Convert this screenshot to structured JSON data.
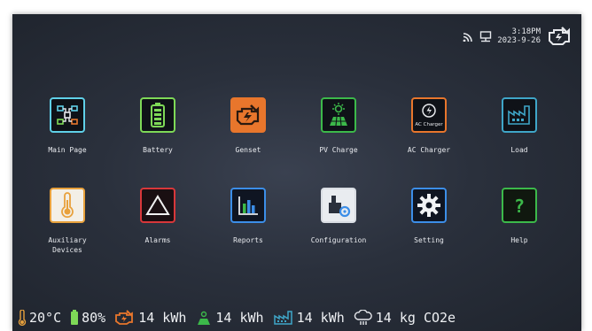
{
  "header": {
    "time": "3:18PM",
    "date": "2023-9-26",
    "icons": [
      "wifi-icon",
      "network-icon",
      "genset-status-icon"
    ]
  },
  "menu": {
    "row1": [
      {
        "label": "Main Page",
        "icon": "main-page-icon",
        "color": "#5fd0e8"
      },
      {
        "label": "Battery",
        "icon": "battery-icon",
        "color": "#7ed957"
      },
      {
        "label": "Genset",
        "icon": "genset-icon",
        "color": "#e8762c"
      },
      {
        "label": "PV Charge",
        "icon": "pv-charge-icon",
        "color": "#3cb94a"
      },
      {
        "label": "AC Charger",
        "icon": "ac-charger-icon",
        "color": "#e8762c",
        "inner_text": "AC Charger"
      },
      {
        "label": "Load",
        "icon": "load-icon",
        "color": "#3fa6c8"
      }
    ],
    "row2": [
      {
        "label": "Auxiliary\nDevices",
        "icon": "thermometer-icon",
        "color": "#e8a13c"
      },
      {
        "label": "Alarms",
        "icon": "alarm-icon",
        "color": "#d8373a"
      },
      {
        "label": "Reports",
        "icon": "reports-icon",
        "color": "#3c8ee8"
      },
      {
        "label": "Configuration",
        "icon": "configuration-icon",
        "color": "#d9dde3"
      },
      {
        "label": "Setting",
        "icon": "setting-icon",
        "color": "#3c8ee8"
      },
      {
        "label": "Help",
        "icon": "help-icon",
        "color": "#3cb94a"
      }
    ]
  },
  "status": {
    "temperature": "20°C",
    "battery": "80%",
    "genset_energy": "14 kWh",
    "pv_energy": "14 kWh",
    "load_energy": "14 kWh",
    "co2": "14 kg CO2e"
  }
}
